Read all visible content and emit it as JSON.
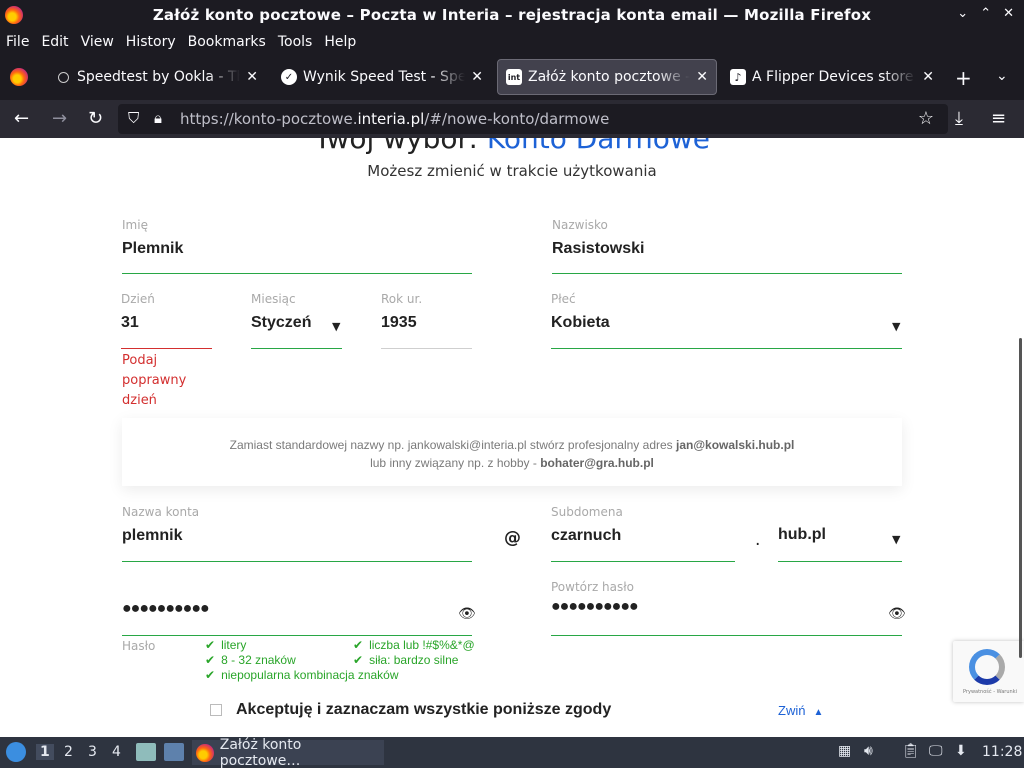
{
  "window": {
    "title": "Załóż konto pocztowe – Poczta w Interia – rejestracja konta email — Mozilla Firefox",
    "controls": [
      "⌄",
      "⌃",
      "✕"
    ]
  },
  "menu": [
    {
      "label": "File"
    },
    {
      "label": "Edit"
    },
    {
      "label": "View"
    },
    {
      "label": "History"
    },
    {
      "label": "Bookmarks"
    },
    {
      "label": "Tools"
    },
    {
      "label": "Help"
    }
  ],
  "tabs": [
    {
      "title": "Speedtest by Ookla - The",
      "icon": "speedtest-icon",
      "active": false
    },
    {
      "title": "Wynik Speed Test - Speed",
      "icon": "speedtest-result-icon",
      "active": false
    },
    {
      "title": "Załóż konto pocztowe – P",
      "icon": "interia-icon",
      "active": true
    },
    {
      "title": "A Flipper Devices store o",
      "icon": "flipper-icon",
      "active": false
    }
  ],
  "tab_close": "✕",
  "new_tab": "+",
  "nav": {
    "url_prefix": "https://konto-pocztowe.",
    "url_domain": "interia.pl",
    "url_suffix": "/#/nowe-konto/darmowe"
  },
  "page": {
    "heading_prefix": "Twój wybór: ",
    "heading_accent": "Konto Darmowe",
    "subheading": "Możesz zmienić w trakcie użytkowania",
    "first_name": {
      "label": "Imię",
      "value": "Plemnik"
    },
    "last_name": {
      "label": "Nazwisko",
      "value": "Rasistowski"
    },
    "day": {
      "label": "Dzień",
      "value": "31",
      "error": "Podaj poprawny dzień"
    },
    "month": {
      "label": "Miesiąc",
      "value": "Styczeń"
    },
    "year": {
      "label": "Rok ur.",
      "value": "1935"
    },
    "gender": {
      "label": "Płeć",
      "value": "Kobieta"
    },
    "info_line1_prefix": "Zamiast standardowej nazwy np. jankowalski@interia.pl stwórz profesjonalny adres ",
    "info_line1_bold": "jan@kowalski.hub.pl",
    "info_line2_prefix": "lub inny związany np. z hobby - ",
    "info_line2_bold": "bohater@gra.hub.pl",
    "account_name": {
      "label": "Nazwa konta",
      "value": "plemnik"
    },
    "at": "@",
    "subdomain": {
      "label": "Subdomena",
      "value": "czarnuch"
    },
    "dot": ".",
    "domain": {
      "value": "hub.pl"
    },
    "password": {
      "label": "Hasło",
      "value": "●●●●●●●●●●"
    },
    "password_repeat": {
      "label": "Powtórz hasło",
      "value": "●●●●●●●●●●"
    },
    "password_hints": [
      "litery",
      "liczba lub !#$%&*@",
      "8 - 32 znaków",
      "siła: bardzo silne",
      "niepopularna kombinacja znaków"
    ],
    "consent_all": "Akceptuję i zaznaczam wszystkie poniższe zgody",
    "collapse": "Zwiń"
  },
  "recaptcha": {
    "legal": "Prywatność - Warunki"
  },
  "taskbar": {
    "workspaces": [
      "1",
      "2",
      "3",
      "4"
    ],
    "active_task": "Załóż konto pocztowe…",
    "clock": "11:28"
  },
  "colors": {
    "accent": "#1d62d6",
    "valid": "#28a745",
    "error": "#d32f2f"
  }
}
